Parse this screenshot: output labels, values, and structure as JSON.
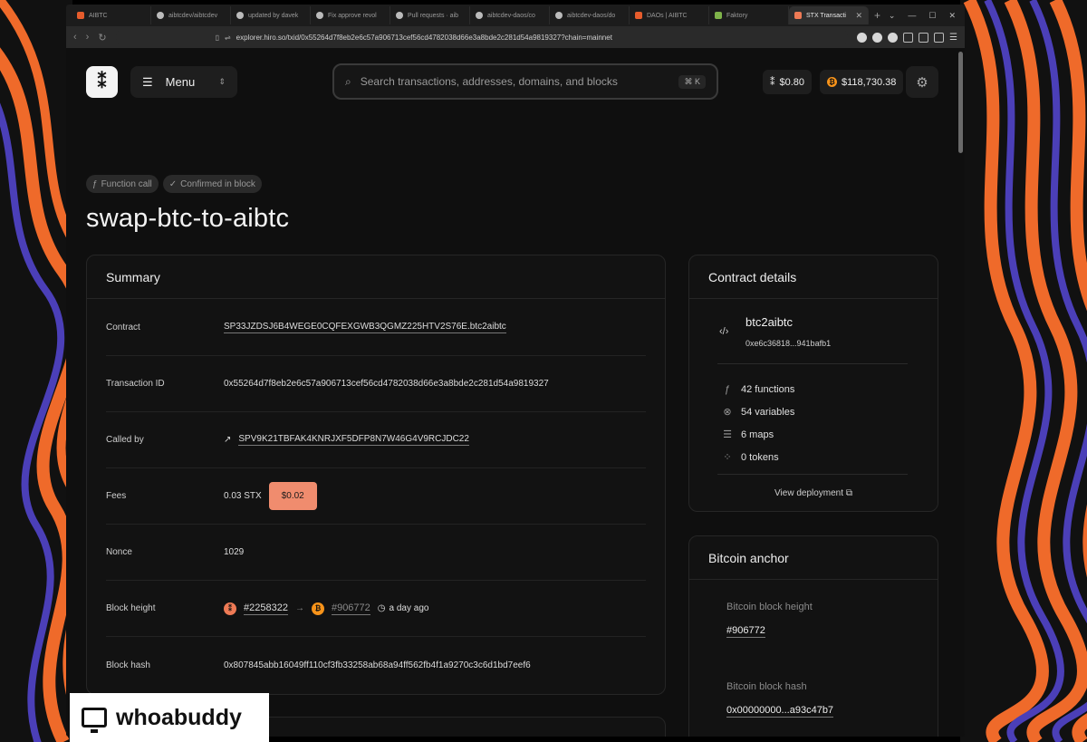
{
  "browser": {
    "tabs": [
      {
        "label": "AIBTC",
        "color": "#e65c2c"
      },
      {
        "label": "aibtcdev/aibtcdev",
        "color": "#bbbbbb"
      },
      {
        "label": "updated by davek",
        "color": "#bbbbbb"
      },
      {
        "label": "Fix approve revol",
        "color": "#bbbbbb"
      },
      {
        "label": "Pull requests · aib",
        "color": "#bbbbbb"
      },
      {
        "label": "aibtcdev-daos/co",
        "color": "#bbbbbb"
      },
      {
        "label": "aibtcdev-daos/do",
        "color": "#bbbbbb"
      },
      {
        "label": "DAOs | AIBTC",
        "color": "#e65c2c"
      },
      {
        "label": "Faktory",
        "color": "#7fb34a"
      },
      {
        "label": "STX Transacti",
        "color": "#ee7a55",
        "active": true
      }
    ],
    "url": "explorer.hiro.so/txid/0x55264d7f8eb2e6c57a906713cef56cd4782038d66e3a8bde2c281d54a9819327?chain=mainnet"
  },
  "header": {
    "menu_label": "Menu",
    "search_placeholder": "Search transactions, addresses, domains, and blocks",
    "search_shortcut": "⌘ K",
    "stx_price": "$0.80",
    "btc_price": "$118,730.38"
  },
  "tx": {
    "badges": [
      "Function call",
      "Confirmed in block"
    ],
    "title": "swap-btc-to-aibtc"
  },
  "summary": {
    "heading": "Summary",
    "rows": {
      "contract": {
        "label": "Contract",
        "value": "SP33JZDSJ6B4WEGE0CQFEXGWB3QGMZ225HTV2S76E.btc2aibtc"
      },
      "txid": {
        "label": "Transaction ID",
        "value": "0x55264d7f8eb2e6c57a906713cef56cd4782038d66e3a8bde2c281d54a9819327"
      },
      "caller": {
        "label": "Called by",
        "value": "SPV9K21TBFAK4KNRJXF5DFP8N7W46G4V9RCJDC22"
      },
      "fees": {
        "label": "Fees",
        "value": "0.03 STX",
        "usd": "$0.02"
      },
      "nonce": {
        "label": "Nonce",
        "value": "1029"
      },
      "block_height": {
        "label": "Block height",
        "stx_block": "#2258322",
        "btc_block": "#906772",
        "age": "a day ago"
      },
      "block_hash": {
        "label": "Block hash",
        "value": "0x807845abb16049ff110cf3fb33258ab68a94ff562fb4f1a9270c3c6d1bd7eef6"
      }
    }
  },
  "contract_details": {
    "heading": "Contract details",
    "name": "btc2aibtc",
    "hash": "0xe6c36818...941bafb1",
    "stats": [
      {
        "icon": "function-icon",
        "glyph": "ƒ",
        "text": "42 functions"
      },
      {
        "icon": "variables-icon",
        "glyph": "⊗",
        "text": "54 variables"
      },
      {
        "icon": "maps-icon",
        "glyph": "☰",
        "text": "6 maps"
      },
      {
        "icon": "tokens-icon",
        "glyph": "⁘",
        "text": "0 tokens"
      }
    ],
    "view_deployment": "View deployment"
  },
  "bitcoin_anchor": {
    "heading": "Bitcoin anchor",
    "height_label": "Bitcoin block height",
    "height_value": "#906772",
    "hash_label": "Bitcoin block hash",
    "hash_value": "0x00000000...a93c47b7"
  },
  "watermark": {
    "text": "whoabuddy"
  }
}
